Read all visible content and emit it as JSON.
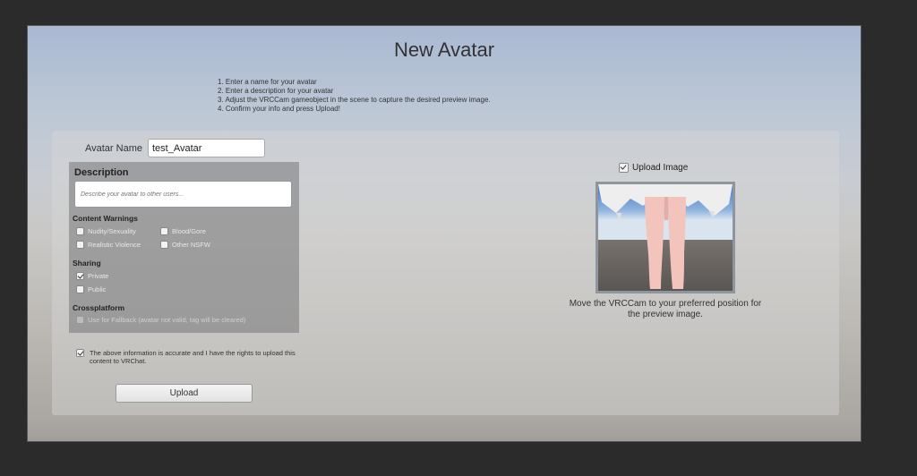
{
  "window": {
    "title": "New Avatar",
    "steps": [
      "1. Enter a name for your avatar",
      "2. Enter a description for your avatar",
      "3. Adjust the VRCCam gameobject in the scene to capture the desired preview image.",
      "4. Confirm your info and press Upload!"
    ]
  },
  "form": {
    "name_label": "Avatar Name",
    "name_value": "test_Avatar",
    "description_header": "Description",
    "description_placeholder": "Describe your avatar to other users...",
    "content_warnings_header": "Content Warnings",
    "content_warnings": [
      {
        "label": "Nudity/Sexuality",
        "checked": false
      },
      {
        "label": "Blood/Gore",
        "checked": false
      },
      {
        "label": "Realistic Violence",
        "checked": false
      },
      {
        "label": "Other NSFW",
        "checked": false
      }
    ],
    "sharing_header": "Sharing",
    "sharing": [
      {
        "label": "Private",
        "checked": true
      },
      {
        "label": "Public",
        "checked": false
      }
    ],
    "crossplatform_header": "Crossplatform",
    "fallback_label": "Use for Fallback (avatar not valid, tag will be cleared)",
    "confirm_text": "The above information is accurate and I have the rights to upload this content to VRChat.",
    "confirm_checked": true,
    "upload_label": "Upload"
  },
  "preview": {
    "upload_image_label": "Upload Image",
    "upload_image_checked": true,
    "caption": "Move the VRCCam to your preferred position for the preview image."
  },
  "colors": {
    "background": "#2b2b2b",
    "panel": "#d6d6d6",
    "description_box": "#767678"
  }
}
